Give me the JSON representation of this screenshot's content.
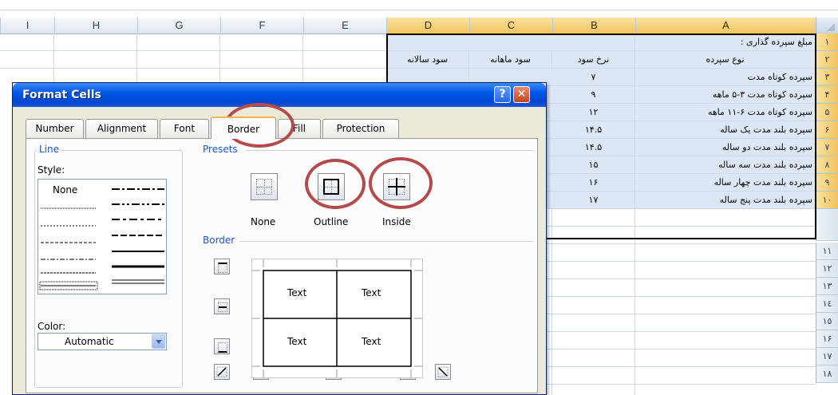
{
  "sheet": {
    "columns": [
      {
        "label": "I"
      },
      {
        "label": "H"
      },
      {
        "label": "G"
      },
      {
        "label": "F"
      },
      {
        "label": "E"
      },
      {
        "label": "D"
      },
      {
        "label": "C"
      },
      {
        "label": "B"
      },
      {
        "label": "A"
      }
    ],
    "rows": [
      "١",
      "٢",
      "٣",
      "۴",
      "۵",
      "۶",
      "٧",
      "٨",
      "٩",
      "١٠",
      "١١",
      "١٢",
      "١٣",
      "١٤",
      "١٥",
      "١۶",
      "١٧",
      "١٨"
    ],
    "title_cell": "مبلغ سپرده گذاری :",
    "headers": {
      "A": "نوع سپرده",
      "B": "نرخ سود",
      "C": "سود ماهانه",
      "D": "سود سالانه"
    },
    "data_rows": [
      {
        "A": "سپرده کوتاه مدت",
        "B": "٧"
      },
      {
        "A": "سپرده کوتاه مدت ٣-۵ ماهه",
        "B": "٩"
      },
      {
        "A": "سپرده کوتاه مدت ۶-١١ ماهه",
        "B": "١٢"
      },
      {
        "A": "سپرده بلند مدت یک ساله",
        "B": "١۴.۵"
      },
      {
        "A": "سپرده بلند مدت دو ساله",
        "B": "١۴.۵"
      },
      {
        "A": "سپرده بلند مدت سه ساله",
        "B": "١۵"
      },
      {
        "A": "سپرده بلند مدت چهار ساله",
        "B": "١۶"
      },
      {
        "A": "سپرده بلند مدت پنج ساله",
        "B": "١٧"
      }
    ]
  },
  "dialog": {
    "title": "Format Cells",
    "help_label": "?",
    "close_label": "✕",
    "tabs": [
      "Number",
      "Alignment",
      "Font",
      "Border",
      "Fill",
      "Protection"
    ],
    "active_tab": "Border",
    "line_group": "Line",
    "style_label": "Style:",
    "style_none": "None",
    "color_label": "Color:",
    "color_value": "Automatic",
    "presets_group": "Presets",
    "presets": [
      "None",
      "Outline",
      "Inside"
    ],
    "border_group": "Border",
    "preview_texts": [
      "Text",
      "Text",
      "Text",
      "Text"
    ],
    "highlight_color": "#b54a4a",
    "accent": "#0058e6"
  }
}
